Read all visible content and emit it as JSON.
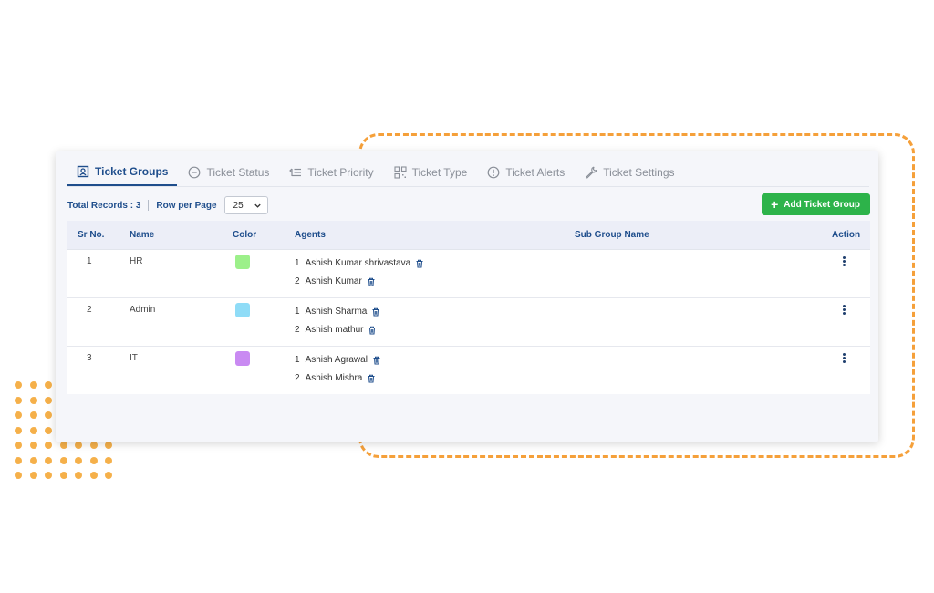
{
  "tabs": [
    {
      "label": "Ticket Groups",
      "icon": "ticket-groups-icon",
      "active": true
    },
    {
      "label": "Ticket Status",
      "icon": "minus-circle-icon"
    },
    {
      "label": "Ticket Priority",
      "icon": "priority-list-icon"
    },
    {
      "label": "Ticket Type",
      "icon": "qr-type-icon"
    },
    {
      "label": "Ticket Alerts",
      "icon": "alert-circle-icon"
    },
    {
      "label": "Ticket Settings",
      "icon": "wrench-icon"
    }
  ],
  "toolbar": {
    "total_records": "Total Records : 3",
    "rows_per_page_label": "Row per Page",
    "rows_per_page_value": "25",
    "add_button_label": "Add Ticket Group"
  },
  "table": {
    "columns": [
      "Sr No.",
      "Name",
      "Color",
      "Agents",
      "Sub Group Name",
      "Action"
    ],
    "rows": [
      {
        "sr": "1",
        "name": "HR",
        "color": "#9cf08a",
        "agents": [
          {
            "num": "1",
            "name": "Ashish Kumar shrivastava"
          },
          {
            "num": "2",
            "name": "Ashish Kumar"
          }
        ]
      },
      {
        "sr": "2",
        "name": "Admin",
        "color": "#8fdcf7",
        "agents": [
          {
            "num": "1",
            "name": "Ashish Sharma"
          },
          {
            "num": "2",
            "name": "Ashish mathur"
          }
        ]
      },
      {
        "sr": "3",
        "name": "IT",
        "color": "#c98af2",
        "agents": [
          {
            "num": "1",
            "name": "Ashish Agrawal"
          },
          {
            "num": "2",
            "name": "Ashish Mishra"
          }
        ]
      }
    ]
  },
  "colors": {
    "accent": "#1f4e8c",
    "add_button": "#2db34a",
    "decor": "#f5a03a"
  }
}
